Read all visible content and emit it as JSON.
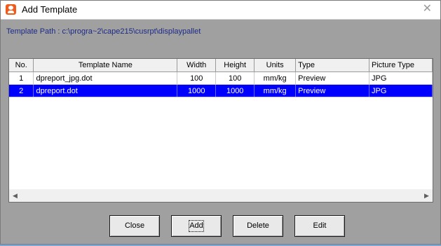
{
  "window": {
    "title": "Add Template",
    "close_glyph": "✕"
  },
  "template_path_label": "Template Path : c:\\progra~2\\cape215\\cusrpt\\displaypallet",
  "table": {
    "columns": [
      "No.",
      "Template Name",
      "Width",
      "Height",
      "Units",
      "Type",
      "Picture Type"
    ],
    "rows": [
      {
        "no": "1",
        "name": "dpreport_jpg.dot",
        "width": "100",
        "height": "100",
        "units": "mm/kg",
        "type": "Preview",
        "picture_type": "JPG"
      },
      {
        "no": "2",
        "name": "dpreport.dot",
        "width": "1000",
        "height": "1000",
        "units": "mm/kg",
        "type": "Preview",
        "picture_type": "JPG"
      }
    ],
    "selected_row": 2
  },
  "scrollbar": {
    "left_glyph": "◀",
    "right_glyph": "▶"
  },
  "buttons": {
    "close": "Close",
    "add": "Add",
    "delete": "Delete",
    "edit": "Edit"
  }
}
